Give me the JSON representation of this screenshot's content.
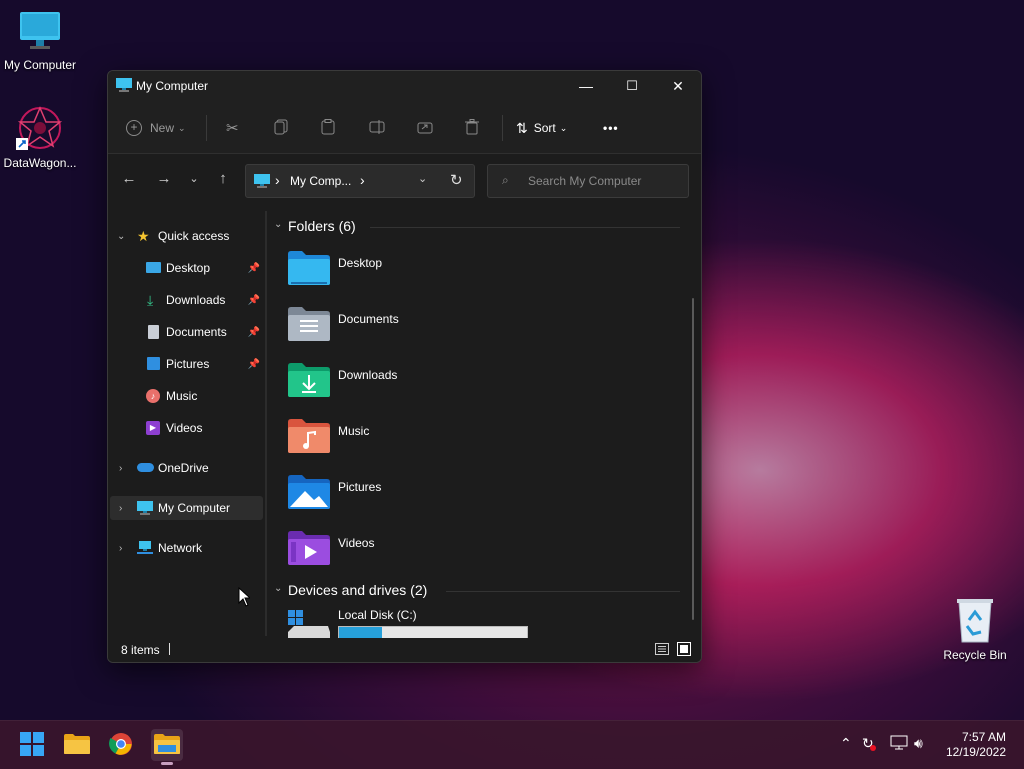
{
  "desktop": {
    "icons": [
      {
        "label": "My Computer"
      },
      {
        "label": "DataWagon..."
      },
      {
        "label": "Recycle Bin"
      }
    ]
  },
  "window": {
    "title": "My Computer",
    "controls": {
      "minimize": "—",
      "maximize": "☐",
      "close": "✕"
    },
    "toolbar": {
      "new_label": "New",
      "sort_label": "Sort",
      "more_label": "•••"
    },
    "address": {
      "path": "My Comp...",
      "separator": "›"
    },
    "search": {
      "placeholder": "Search My Computer"
    },
    "sidebar": {
      "quick_access": "Quick access",
      "items": [
        {
          "label": "Desktop"
        },
        {
          "label": "Downloads"
        },
        {
          "label": "Documents"
        },
        {
          "label": "Pictures"
        },
        {
          "label": "Music"
        },
        {
          "label": "Videos"
        }
      ],
      "onedrive": "OneDrive",
      "my_computer": "My Computer",
      "network": "Network"
    },
    "content": {
      "folders_header": "Folders (6)",
      "folders": [
        {
          "name": "Desktop"
        },
        {
          "name": "Documents"
        },
        {
          "name": "Downloads"
        },
        {
          "name": "Music"
        },
        {
          "name": "Pictures"
        },
        {
          "name": "Videos"
        }
      ],
      "devices_header": "Devices and drives (2)",
      "drives": [
        {
          "name": "Local Disk (C:)",
          "usage_fraction": 0.23
        }
      ]
    },
    "status": {
      "items": "8 items"
    }
  },
  "taskbar": {
    "clock_time": "7:57 AM",
    "clock_date": "12/19/2022"
  },
  "colors": {
    "accent": "#0078d4",
    "drive_bar": "#26a0da",
    "window_bg": "#1c1c1c"
  }
}
